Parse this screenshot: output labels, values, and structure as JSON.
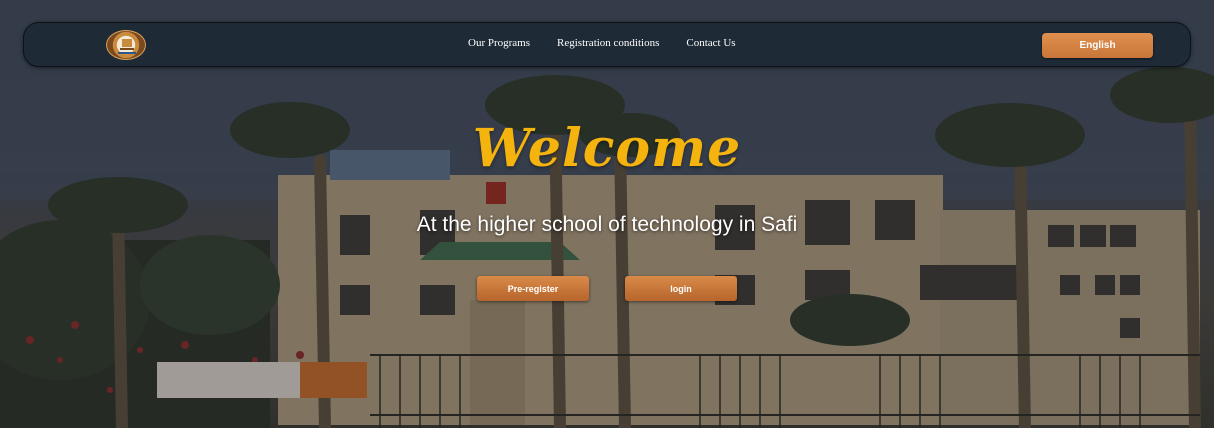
{
  "navbar": {
    "logo_name": "school-logo",
    "links": [
      "Our Programs",
      "Registration conditions",
      "Contact Us"
    ],
    "language_label": "English"
  },
  "hero": {
    "title": "Welcome",
    "subtitle": "At the higher school of technology in Safi",
    "preregister_label": "Pre-register",
    "login_label": "login"
  },
  "colors": {
    "accent_orange": "#d98a48",
    "title_gold": "#f5b30d",
    "navbar_bg": "#1e2a36"
  }
}
